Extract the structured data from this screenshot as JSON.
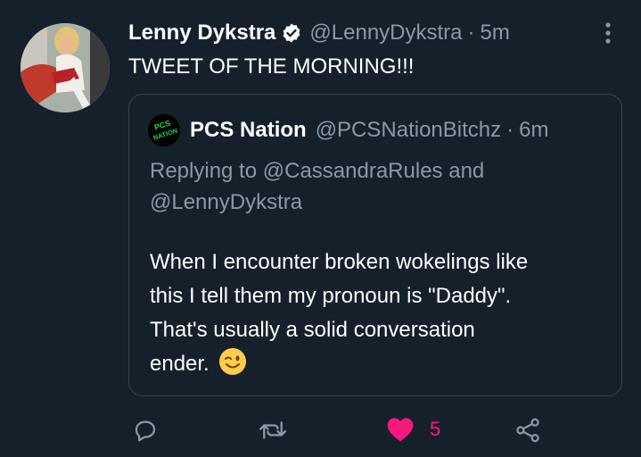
{
  "tweet": {
    "author_name": "Lenny Dykstra",
    "author_handle": "@LennyDykstra",
    "separator": "·",
    "time": "5m",
    "text": "TWEET OF THE MORNING!!!"
  },
  "quoted_tweet": {
    "author_name": "PCS Nation",
    "author_handle": "@PCSNationBitchz",
    "separator": "·",
    "time": "6m",
    "avatar_text": "PCS NATION",
    "replying_prefix": "Replying to",
    "replying_mention_1": "@CassandraRules",
    "replying_and": "and",
    "replying_mention_2": "@LennyDykstra",
    "body_lines": [
      "When I encounter broken wokelings like",
      "this I tell them my pronoun is \"Daddy\".",
      "That's usually a solid conversation",
      "ender."
    ],
    "emoji": "winking-face-emoji"
  },
  "actions": {
    "reply_icon": "reply-icon",
    "retweet_icon": "retweet-icon",
    "like_icon": "heart-icon",
    "like_count": "5",
    "share_icon": "share-icon"
  },
  "colors": {
    "background": "#15202b",
    "text": "#ffffff",
    "secondary_text": "#8b98a5",
    "border": "#38444d",
    "like": "#f91880",
    "icon": "#8b98a5",
    "verified_badge": "#ffffff",
    "quote_avatar_text": "#22d24a"
  }
}
